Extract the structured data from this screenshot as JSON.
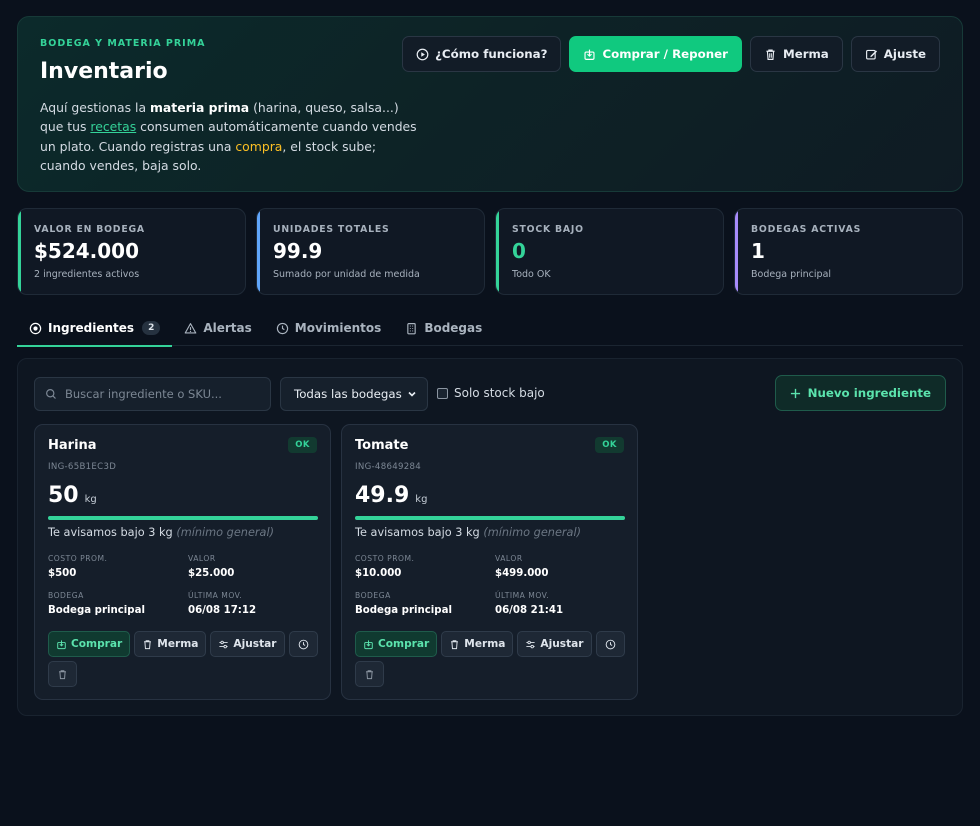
{
  "hero": {
    "kicker": "BODEGA Y MATERIA PRIMA",
    "title": "Inventario",
    "desc_1": "Aquí gestionas la ",
    "desc_bold": "materia prima",
    "desc_2": " (harina, queso, salsa...) que tus ",
    "desc_link": "recetas",
    "desc_3": " consumen automáticamente cuando vendes un plato. Cuando registras una ",
    "desc_accent": "compra",
    "desc_4": ", el stock sube; cuando vendes, baja solo.",
    "actions": {
      "how": "¿Cómo funciona?",
      "buy": "Comprar / Reponer",
      "waste": "Merma",
      "adjust": "Ajuste"
    }
  },
  "stats": [
    {
      "label": "VALOR EN BODEGA",
      "value": "$524.000",
      "sub": "2 ingredientes activos"
    },
    {
      "label": "UNIDADES TOTALES",
      "value": "99.9",
      "sub": "Sumado por unidad de medida"
    },
    {
      "label": "STOCK BAJO",
      "value": "0",
      "sub": "Todo OK"
    },
    {
      "label": "BODEGAS ACTIVAS",
      "value": "1",
      "sub": "Bodega principal"
    }
  ],
  "tabs": [
    {
      "label": "Ingredientes",
      "count": "2"
    },
    {
      "label": "Alertas"
    },
    {
      "label": "Movimientos"
    },
    {
      "label": "Bodegas"
    }
  ],
  "toolbar": {
    "search_placeholder": "Buscar ingrediente o SKU...",
    "warehouse_selected": "Todas las bodegas",
    "low_stock_label": "Solo stock bajo",
    "new_ingredient": "Nuevo ingrediente"
  },
  "labels": {
    "cost": "COSTO PROM.",
    "value": "VALOR",
    "warehouse": "BODEGA",
    "last_move": "ÚLTIMA MOV.",
    "alert_prefix": "Te avisamos bajo ",
    "alert_note": "(mínimo general)",
    "buy": "Comprar",
    "waste": "Merma",
    "adjust": "Ajustar"
  },
  "ingredients": [
    {
      "name": "Harina",
      "badge": "OK",
      "sku": "ING-65B1EC3D",
      "qty": "50",
      "unit": "kg",
      "stock_fill": 1.0,
      "alert": "3 kg",
      "cost": "$500",
      "value": "$25.000",
      "warehouse": "Bodega principal",
      "last_move": "06/08 17:12"
    },
    {
      "name": "Tomate",
      "badge": "OK",
      "sku": "ING-48649284",
      "qty": "49.9",
      "unit": "kg",
      "stock_fill": 1.0,
      "alert": "3 kg",
      "cost": "$10.000",
      "value": "$499.000",
      "warehouse": "Bodega principal",
      "last_move": "06/08 21:41"
    }
  ]
}
